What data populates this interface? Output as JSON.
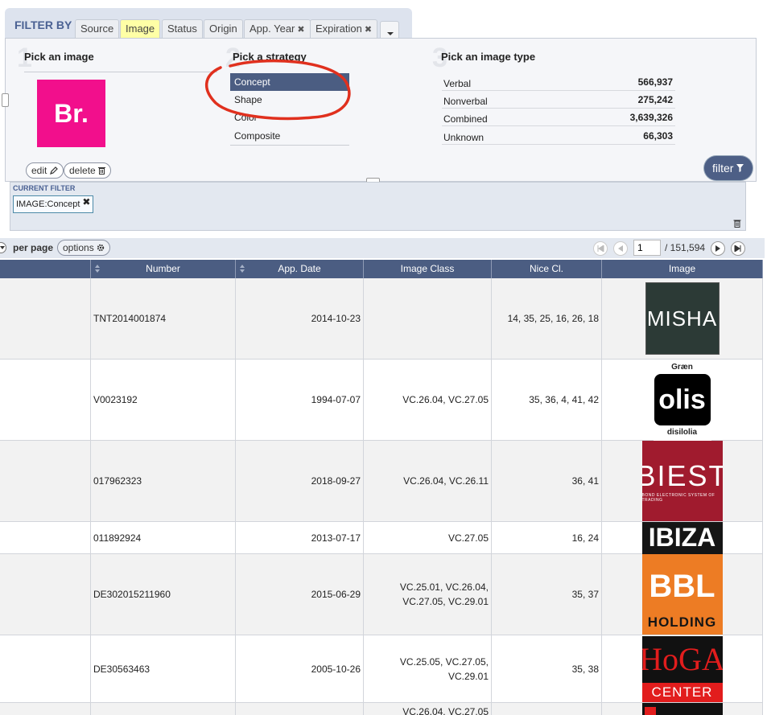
{
  "filter": {
    "title": "FILTER BY",
    "tabs": [
      {
        "label": "Source",
        "closable": false,
        "active": false
      },
      {
        "label": "Image",
        "closable": false,
        "active": true
      },
      {
        "label": "Status",
        "closable": false,
        "active": false
      },
      {
        "label": "Origin",
        "closable": false,
        "active": false
      },
      {
        "label": "App. Year",
        "closable": true,
        "active": false
      },
      {
        "label": "Expiration",
        "closable": true,
        "active": false
      }
    ],
    "close_glyph": "✖",
    "steps": {
      "n1": "1",
      "n2": "2",
      "n3": "3",
      "pick_image": "Pick an image",
      "pick_strategy": "Pick a strategy",
      "pick_type": "Pick an image type"
    },
    "image_logo_text": "Br.",
    "edit_label": "edit",
    "delete_label": "delete",
    "strategies": [
      "Concept",
      "Shape",
      "Color",
      "Composite"
    ],
    "selected_strategy": "Concept",
    "image_types": [
      {
        "label": "Verbal",
        "count": "566,937"
      },
      {
        "label": "Nonverbal",
        "count": "275,242"
      },
      {
        "label": "Combined",
        "count": "3,639,326"
      },
      {
        "label": "Unknown",
        "count": "66,303"
      }
    ],
    "filter_button": "filter"
  },
  "current_filter": {
    "title": "CURRENT FILTER",
    "chip": "IMAGE:Concept",
    "chip_close": "✖"
  },
  "pager": {
    "per_page": "per page",
    "options": "options",
    "page": "1",
    "total": "/ 151,594"
  },
  "table": {
    "columns": [
      "Number",
      "App. Date",
      "Image Class",
      "Nice Cl.",
      "Image"
    ],
    "rows": [
      {
        "number": "TNT2014001874",
        "date": "2014-10-23",
        "image_class": "",
        "nice": "14, 35, 25, 16, 26, 18",
        "mark": "MISHA"
      },
      {
        "number": "V0023192",
        "date": "1994-07-07",
        "image_class": "VC.26.04, VC.27.05",
        "nice": "35, 36, 4, 41, 42",
        "mark": "olis",
        "mark_top": "Græn",
        "mark_bottom": "disilolia"
      },
      {
        "number": "017962323",
        "date": "2018-09-27",
        "image_class": "VC.26.04, VC.26.11",
        "nice": "36, 41",
        "mark": "BIEST",
        "mark_bottom": "BOND ELECTRONIC SYSTEM OF TRADING"
      },
      {
        "number": "011892924",
        "date": "2013-07-17",
        "image_class": "VC.27.05",
        "nice": "16, 24",
        "mark": "IBIZA"
      },
      {
        "number": "DE302015211960",
        "date": "2015-06-29",
        "image_class_lines": [
          "VC.25.01, VC.26.04,",
          "VC.27.05, VC.29.01"
        ],
        "nice": "35, 37",
        "mark": "BBL",
        "mark_bottom": "HOLDING"
      },
      {
        "number": "DE30563463",
        "date": "2005-10-26",
        "image_class_lines": [
          "VC.25.05, VC.27.05,",
          "VC.29.01"
        ],
        "nice": "35, 38",
        "mark": "HoGA",
        "mark_bottom": "CENTER"
      },
      {
        "number": "",
        "date": "",
        "image_class": "VC.26.04, VC.27.05",
        "nice": "",
        "mark": ""
      }
    ]
  },
  "colors": {
    "header_bg": "#4b5d82",
    "tab_active": "#ffffa6",
    "accent_text": "#4a6193",
    "annotation_red": "#e0301e"
  }
}
